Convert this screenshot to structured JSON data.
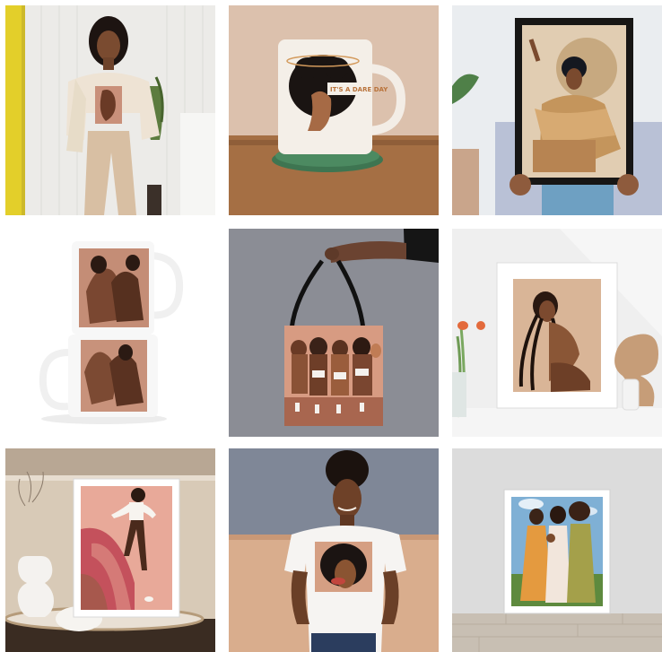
{
  "gallery": {
    "tiles": [
      {
        "subject": "woman-in-sweatshirt",
        "colors": {
          "bg": "#ececea",
          "accent": "#e3cf2a"
        }
      },
      {
        "subject": "mug-on-coaster",
        "colors": {
          "bg": "#d8b9a2",
          "table": "#a16d43"
        }
      },
      {
        "subject": "framed-print-held",
        "colors": {
          "bg": "#e9ecef",
          "frame": "#1c1c1c"
        }
      },
      {
        "subject": "stacked-mugs",
        "colors": {
          "bg": "#ffffff",
          "art": "#c48f79"
        }
      },
      {
        "subject": "tote-bag",
        "colors": {
          "bg": "#8a8c94",
          "bag": "#d49a7e"
        }
      },
      {
        "subject": "framed-print-braids",
        "colors": {
          "bg": "#efefef",
          "art": "#d9b596"
        }
      },
      {
        "subject": "framed-print-dancer",
        "colors": {
          "bg": "#d9cbb9",
          "art": "#c85b63"
        }
      },
      {
        "subject": "woman-in-tshirt",
        "colors": {
          "bg": "#d9ad8d",
          "wall": "#7f8797"
        }
      },
      {
        "subject": "framed-print-three-women",
        "colors": {
          "bg": "#dadada",
          "floor": "#c9bfb2"
        }
      }
    ],
    "mug_print": "IT'S A DARE DAY"
  }
}
